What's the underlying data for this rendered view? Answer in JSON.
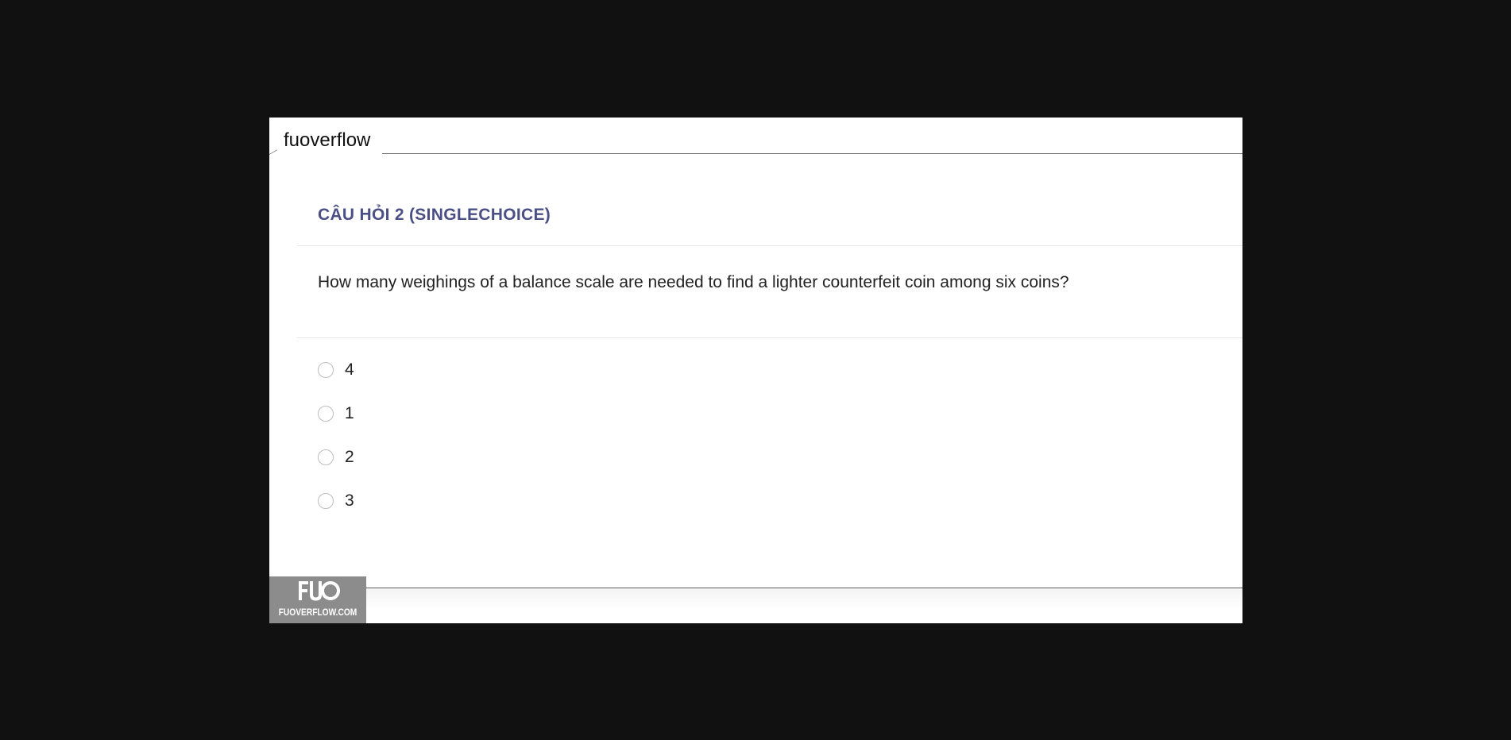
{
  "site": {
    "title": "fuoverflow"
  },
  "question": {
    "header": "CÂU HỎI 2 (SINGLECHOICE)",
    "text": "How many weighings of a balance scale are needed to find a lighter counterfeit coin among six coins?",
    "options": [
      {
        "label": "4",
        "selected": false
      },
      {
        "label": "1",
        "selected": false
      },
      {
        "label": "2",
        "selected": false
      },
      {
        "label": "3",
        "selected": false
      }
    ]
  },
  "watermark": {
    "mark": "FUO",
    "text": "FUOVERFLOW.COM"
  },
  "colors": {
    "background": "#111111",
    "panel": "#ffffff",
    "header_accent": "#4a4f86",
    "watermark_bg": "#8c8c8c"
  }
}
